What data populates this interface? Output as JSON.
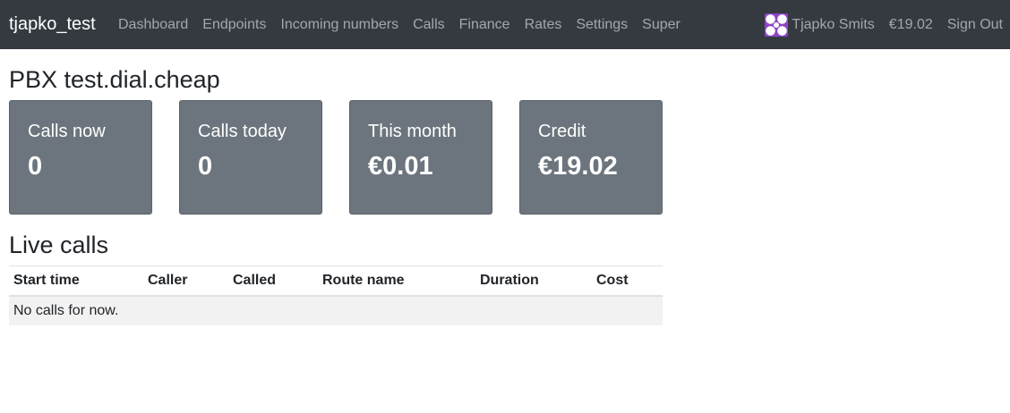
{
  "navbar": {
    "brand": "tjapko_test",
    "links": [
      "Dashboard",
      "Endpoints",
      "Incoming numbers",
      "Calls",
      "Finance",
      "Rates",
      "Settings",
      "Super"
    ],
    "user_name": "Tjapko Smits",
    "balance": "€19.02",
    "sign_out": "Sign Out"
  },
  "page": {
    "title": "PBX test.dial.cheap"
  },
  "cards": [
    {
      "label": "Calls now",
      "value": "0"
    },
    {
      "label": "Calls today",
      "value": "0"
    },
    {
      "label": "This month",
      "value": "€0.01"
    },
    {
      "label": "Credit",
      "value": "€19.02"
    }
  ],
  "live_calls": {
    "title": "Live calls",
    "columns": [
      "Start time",
      "Caller",
      "Called",
      "Route name",
      "Duration",
      "Cost"
    ],
    "empty_message": "No calls for now."
  },
  "colors": {
    "navbar_bg": "#343a40",
    "card_bg": "#6c757d",
    "avatar": "#8e44c8"
  }
}
